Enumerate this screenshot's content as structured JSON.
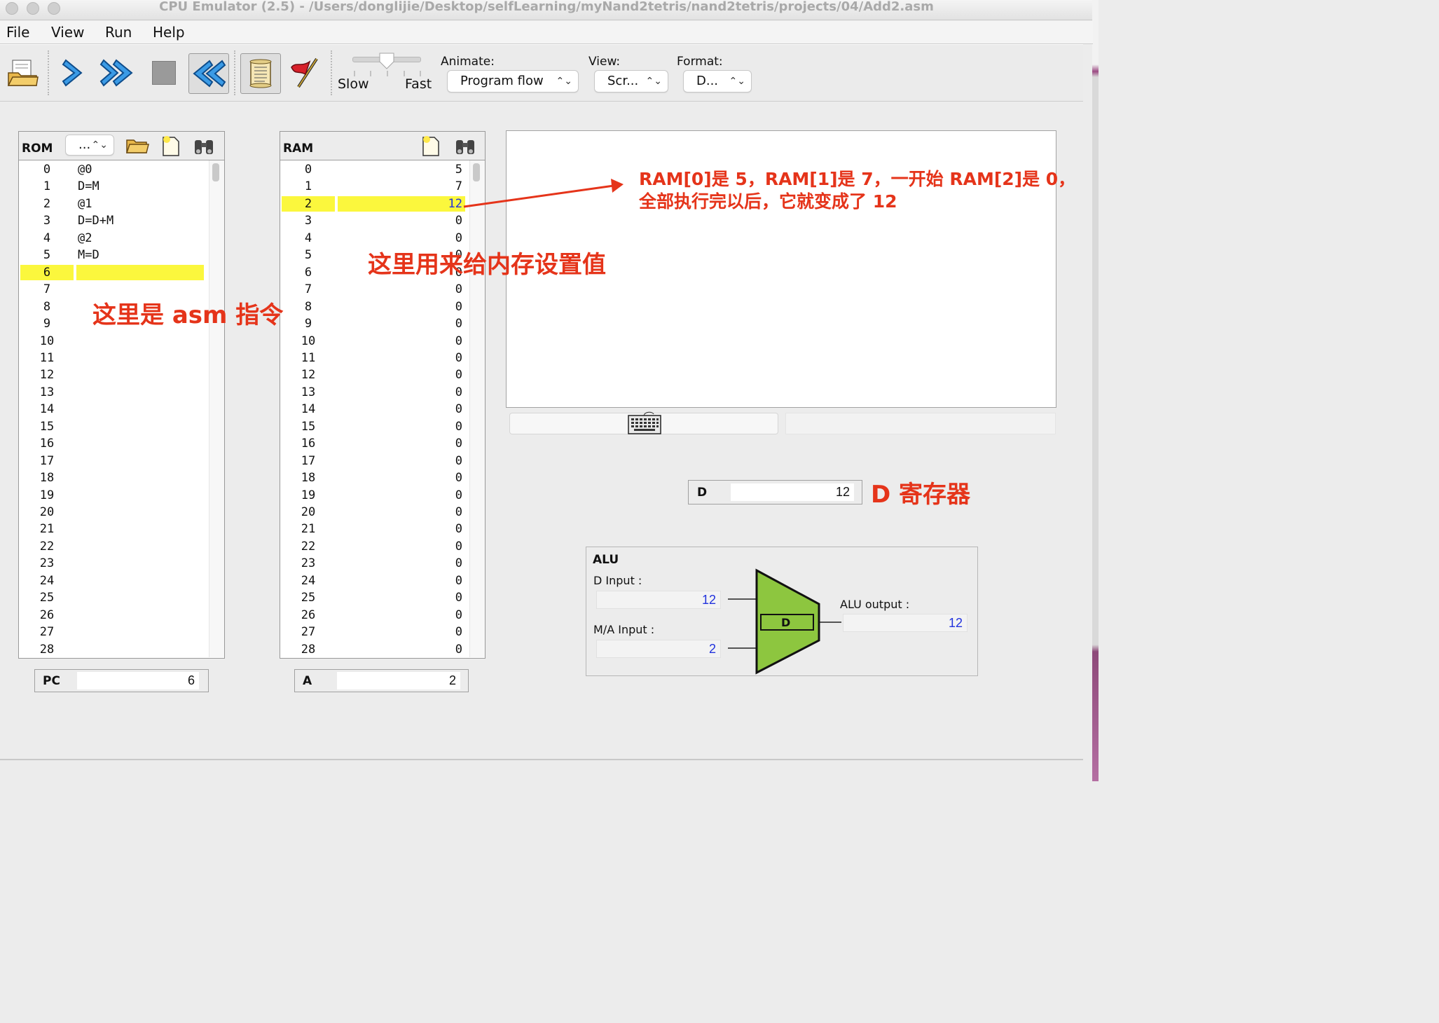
{
  "window": {
    "title": "CPU Emulator (2.5) - /Users/donglijie/Desktop/selfLearning/myNand2tetris/nand2tetris/projects/04/Add2.asm"
  },
  "menu": [
    "File",
    "View",
    "Run",
    "Help"
  ],
  "toolbar": {
    "icons": [
      "load-program-icon",
      "single-step-icon",
      "run-icon",
      "stop-icon",
      "reset-icon",
      "script-icon",
      "breakpoints-icon"
    ],
    "speed": {
      "slow": "Slow",
      "fast": "Fast",
      "level": 0.5
    },
    "animate": {
      "label": "Animate:",
      "value": "Program flow"
    },
    "view": {
      "label": "View:",
      "value": "Scr..."
    },
    "format": {
      "label": "Format:",
      "value": "D..."
    }
  },
  "rom": {
    "label": "ROM",
    "combo": "...",
    "rows": [
      {
        "addr": "0",
        "val": "@0"
      },
      {
        "addr": "1",
        "val": "D=M"
      },
      {
        "addr": "2",
        "val": "@1"
      },
      {
        "addr": "3",
        "val": "D=D+M"
      },
      {
        "addr": "4",
        "val": "@2"
      },
      {
        "addr": "5",
        "val": "M=D"
      },
      {
        "addr": "6",
        "val": "",
        "highlight": true
      },
      {
        "addr": "7",
        "val": ""
      },
      {
        "addr": "8",
        "val": ""
      },
      {
        "addr": "9",
        "val": ""
      },
      {
        "addr": "10",
        "val": ""
      },
      {
        "addr": "11",
        "val": ""
      },
      {
        "addr": "12",
        "val": ""
      },
      {
        "addr": "13",
        "val": ""
      },
      {
        "addr": "14",
        "val": ""
      },
      {
        "addr": "15",
        "val": ""
      },
      {
        "addr": "16",
        "val": ""
      },
      {
        "addr": "17",
        "val": ""
      },
      {
        "addr": "18",
        "val": ""
      },
      {
        "addr": "19",
        "val": ""
      },
      {
        "addr": "20",
        "val": ""
      },
      {
        "addr": "21",
        "val": ""
      },
      {
        "addr": "22",
        "val": ""
      },
      {
        "addr": "23",
        "val": ""
      },
      {
        "addr": "24",
        "val": ""
      },
      {
        "addr": "25",
        "val": ""
      },
      {
        "addr": "26",
        "val": ""
      },
      {
        "addr": "27",
        "val": ""
      },
      {
        "addr": "28",
        "val": ""
      }
    ]
  },
  "ram": {
    "label": "RAM",
    "rows": [
      {
        "addr": "0",
        "val": "5"
      },
      {
        "addr": "1",
        "val": "7"
      },
      {
        "addr": "2",
        "val": "12",
        "highlight": true
      },
      {
        "addr": "3",
        "val": "0"
      },
      {
        "addr": "4",
        "val": "0"
      },
      {
        "addr": "5",
        "val": "0"
      },
      {
        "addr": "6",
        "val": "0"
      },
      {
        "addr": "7",
        "val": "0"
      },
      {
        "addr": "8",
        "val": "0"
      },
      {
        "addr": "9",
        "val": "0"
      },
      {
        "addr": "10",
        "val": "0"
      },
      {
        "addr": "11",
        "val": "0"
      },
      {
        "addr": "12",
        "val": "0"
      },
      {
        "addr": "13",
        "val": "0"
      },
      {
        "addr": "14",
        "val": "0"
      },
      {
        "addr": "15",
        "val": "0"
      },
      {
        "addr": "16",
        "val": "0"
      },
      {
        "addr": "17",
        "val": "0"
      },
      {
        "addr": "18",
        "val": "0"
      },
      {
        "addr": "19",
        "val": "0"
      },
      {
        "addr": "20",
        "val": "0"
      },
      {
        "addr": "21",
        "val": "0"
      },
      {
        "addr": "22",
        "val": "0"
      },
      {
        "addr": "23",
        "val": "0"
      },
      {
        "addr": "24",
        "val": "0"
      },
      {
        "addr": "25",
        "val": "0"
      },
      {
        "addr": "26",
        "val": "0"
      },
      {
        "addr": "27",
        "val": "0"
      },
      {
        "addr": "28",
        "val": "0"
      }
    ]
  },
  "registers": {
    "pc": {
      "label": "PC",
      "value": "6"
    },
    "a": {
      "label": "A",
      "value": "2"
    },
    "d": {
      "label": "D",
      "value": "12"
    }
  },
  "alu": {
    "title": "ALU",
    "d_input_label": "D Input :",
    "d_input": "12",
    "ma_input_label": "M/A Input :",
    "ma_input": "2",
    "output_label": "ALU output :",
    "output": "12",
    "op": "D"
  },
  "annotations": {
    "ram_result_line1": "RAM[0]是 5，RAM[1]是 7，一开始 RAM[2]是 0，",
    "ram_result_line2": "全部执行完以后，它就变成了 12",
    "ram_set": "这里用来给内存设置值",
    "asm": "这里是 asm 指令",
    "d_reg": "D 寄存器"
  },
  "colors": {
    "highlight": "#fbf73d",
    "annotation": "#e5341a",
    "value_blue": "#2233dd",
    "alu_green": "#8dc63f"
  }
}
